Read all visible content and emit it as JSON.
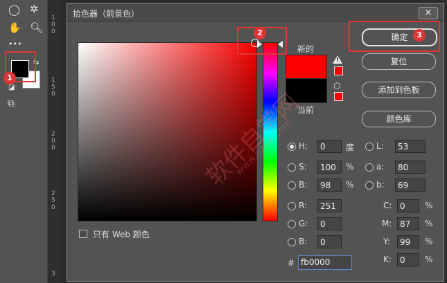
{
  "dialog": {
    "title": "拾色器（前景色）",
    "close": "×",
    "new_label": "新的",
    "current_label": "当前",
    "new_color": "#fb0000",
    "current_color": "#000000",
    "buttons": {
      "ok": "确定",
      "reset": "复位",
      "add_to_swatches": "添加到色板",
      "color_libraries": "颜色库"
    },
    "only_web": "只有 Web 颜色",
    "hsb": {
      "h_label": "H:",
      "h_value": "0",
      "h_unit": "度",
      "s_label": "S:",
      "s_value": "100",
      "s_unit": "%",
      "b_label": "B:",
      "b_value": "98",
      "b_unit": "%"
    },
    "lab": {
      "l_label": "L:",
      "l_value": "53",
      "a_label": "a:",
      "a_value": "80",
      "b_label": "b:",
      "b_value": "69"
    },
    "rgb": {
      "r_label": "R:",
      "r_value": "251",
      "g_label": "G:",
      "g_value": "0",
      "b_label": "B:",
      "b_value": "0"
    },
    "cmyk": {
      "c_label": "C:",
      "c_value": "0",
      "m_label": "M:",
      "m_value": "87",
      "y_label": "Y:",
      "y_value": "99",
      "k_label": "K:",
      "k_value": "0",
      "unit": "%"
    },
    "hex_label": "#",
    "hex_value": "fb0000"
  },
  "annotations": [
    "1",
    "2",
    "3"
  ],
  "watermark": "软件自学网",
  "watermark_url": "www.rjzxw.com",
  "ruler_marks": [
    "1",
    "0",
    "0",
    "1",
    "5",
    "0",
    "2",
    "0",
    "0",
    "2",
    "5",
    "0",
    "3"
  ]
}
